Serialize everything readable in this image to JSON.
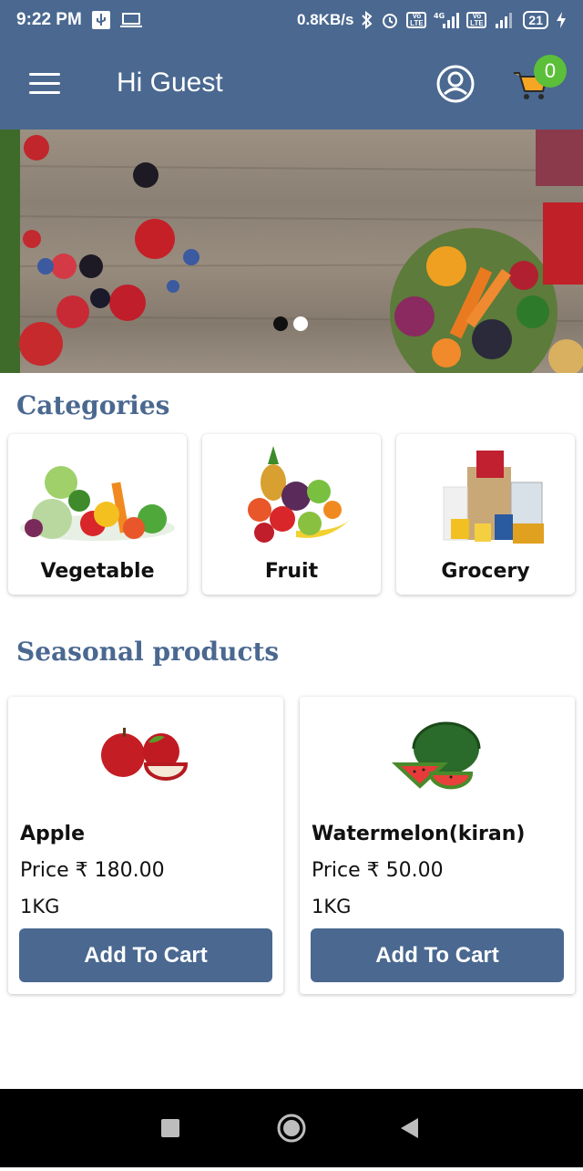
{
  "status_bar": {
    "time": "9:22 PM",
    "network_speed": "0.8KB/s",
    "battery": "21",
    "left_icons": [
      "usb-icon",
      "laptop-icon"
    ],
    "right_icons": [
      "bluetooth-icon",
      "alarm-icon",
      "volte-icon",
      "signal-icon",
      "volte-icon",
      "signal-icon",
      "battery-icon",
      "charging-icon"
    ],
    "volte_label": "Vo LTE",
    "network_type": "4G"
  },
  "header": {
    "greeting": "Hi Guest",
    "cart_count": "0",
    "icons": [
      "menu-icon",
      "account-icon",
      "cart-icon"
    ],
    "colors": {
      "primary": "#4a6890",
      "cart_badge": "#5cbf3a",
      "cart": "#f5a623"
    }
  },
  "banner": {
    "slides": 2,
    "active_slide": 1
  },
  "categories": {
    "title": "Categories",
    "items": [
      {
        "label": "Vegetable",
        "icon": "vegetables-image"
      },
      {
        "label": "Fruit",
        "icon": "fruits-image"
      },
      {
        "label": "Grocery",
        "icon": "grocery-image"
      }
    ]
  },
  "seasonal": {
    "title": "Seasonal products",
    "products": [
      {
        "name": "Apple",
        "price": "Price ₹ 180.00",
        "quantity": "1KG",
        "button": "Add To Cart",
        "image": "apple-image"
      },
      {
        "name": "Watermelon(kiran)",
        "price": "Price ₹ 50.00",
        "quantity": "1KG",
        "button": "Add To Cart",
        "image": "watermelon-image"
      }
    ]
  },
  "nav_bar": {
    "icons": [
      "recents-icon",
      "home-icon",
      "back-icon"
    ]
  }
}
